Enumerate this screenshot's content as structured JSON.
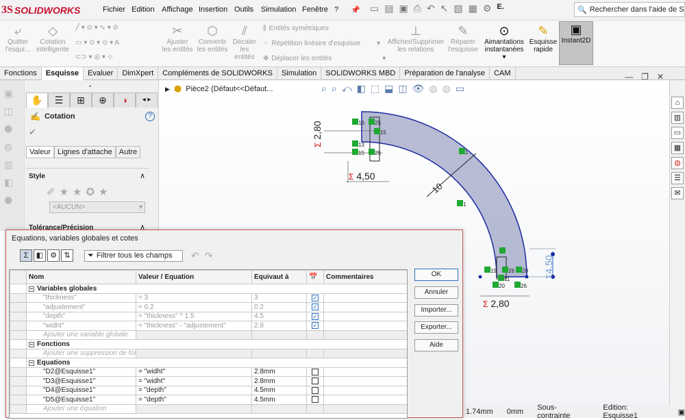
{
  "menubar": {
    "app": "SOLIDWORKS",
    "items": [
      "Fichier",
      "Edition",
      "Affichage",
      "Insertion",
      "Outils",
      "Simulation",
      "Fenêtre",
      "?"
    ],
    "search_label": "Rechercher dans l'aide de SOLIDW"
  },
  "ribbon": {
    "buttons": [
      {
        "label": "Quitter l'esqui...",
        "icon": "exit-sketch-icon"
      },
      {
        "label": "Cotation intelligente",
        "icon": "smart-dimension-icon"
      },
      {
        "label": "Ajuster les entités",
        "icon": "trim-icon"
      },
      {
        "label": "Convertir les entités",
        "icon": "convert-icon"
      },
      {
        "label": "Décaler les entités",
        "icon": "offset-icon"
      },
      {
        "label": "Afficher/Supprimer les relations",
        "icon": "relations-icon"
      },
      {
        "label": "Réparer l'esquisse",
        "icon": "repair-icon"
      },
      {
        "label": "Aimantations instantanées",
        "icon": "snap-icon"
      },
      {
        "label": "Esquisse rapide",
        "icon": "rapid-sketch-icon"
      },
      {
        "label": "Instant2D",
        "icon": "instant2d-icon"
      }
    ],
    "small": [
      "Entités symétriques",
      "Répétition linéaire d'esquisse",
      "Déplacer les entités"
    ]
  },
  "tabs": [
    "Fonctions",
    "Esquisse",
    "Evaluer",
    "DimXpert",
    "Compléments de SOLIDWORKS",
    "Simulation",
    "SOLIDWORKS MBD",
    "Préparation de l'analyse",
    "CAM"
  ],
  "active_tab": "Esquisse",
  "property_manager": {
    "title": "Cotation",
    "subtabs": [
      "Valeur",
      "Lignes d'attache",
      "Autre"
    ],
    "style_label": "Style",
    "style_value": "<AUCUN>",
    "tolerance_label": "Tolérance/Précision"
  },
  "graphics": {
    "tree_label": "Pièce2  (Défaut<<Défaut...",
    "dims": {
      "d_top": "2,80",
      "d_left": "4,50",
      "d_radial": "10",
      "d_right": "4,50",
      "d_bottom": "2,80"
    },
    "markers": [
      "16",
      "25",
      "15",
      "13",
      "15",
      "25",
      "1",
      "1",
      "19",
      "26",
      "20",
      "20",
      "26",
      "11"
    ]
  },
  "status": {
    "coord": "1.74mm",
    "z": "0mm",
    "state": "Sous-contrainte",
    "mode": "Edition: Esquisse1"
  },
  "dialog": {
    "title": "Equations, variables globales et cotes",
    "filter": "Filtrer tous les champs",
    "columns": [
      "Nom",
      "Valeur / Equation",
      "Equivaut à",
      "",
      "Commentaires"
    ],
    "groups": {
      "globals": {
        "label": "Variables globales",
        "rows": [
          {
            "name": "\"thickness\"",
            "value": "= 3",
            "eq": "3",
            "checked": true
          },
          {
            "name": "\"adjustement\"",
            "value": "= 0.2",
            "eq": "0.2",
            "checked": true
          },
          {
            "name": "\"depth\"",
            "value": "= \"thickness\" ^ 1.5",
            "eq": "4.5",
            "checked": true
          },
          {
            "name": "\"widht\"",
            "value": "= \"thickness\" - \"adjustement\"",
            "eq": "2.8",
            "checked": true
          }
        ],
        "add": "Ajouter une variable globale"
      },
      "functions": {
        "label": "Fonctions",
        "add": "Ajouter une suppression de foncti"
      },
      "equations": {
        "label": "Equations",
        "rows": [
          {
            "name": "\"D2@Esquisse1\"",
            "value": "= \"widht\"",
            "eq": "2.8mm",
            "checked": false
          },
          {
            "name": "\"D3@Esquisse1\"",
            "value": "= \"widht\"",
            "eq": "2.8mm",
            "checked": false
          },
          {
            "name": "\"D4@Esquisse1\"",
            "value": "= \"depth\"",
            "eq": "4.5mm",
            "checked": false
          },
          {
            "name": "\"D5@Esquisse1\"",
            "value": "= \"depth\"",
            "eq": "4.5mm",
            "checked": false
          }
        ],
        "add": "Ajouter une équation"
      }
    },
    "buttons": {
      "ok": "OK",
      "cancel": "Annuler",
      "import": "Importer...",
      "export": "Exporter...",
      "help": "Aide"
    }
  }
}
